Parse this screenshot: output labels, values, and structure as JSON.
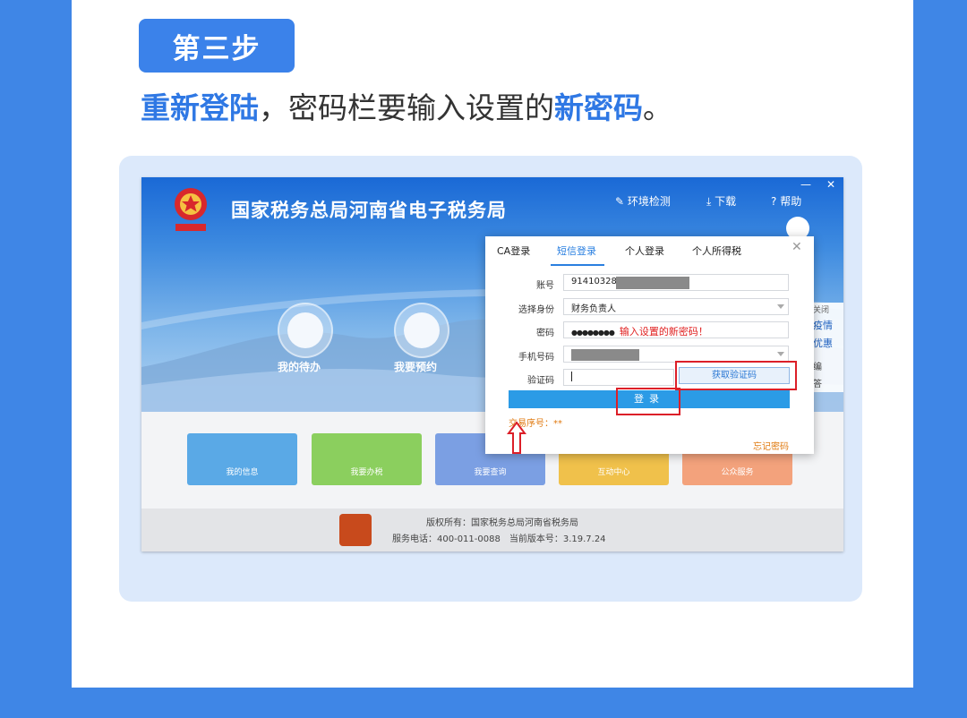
{
  "step": {
    "label": "第三步"
  },
  "headline": {
    "part1": "重新登陆",
    "part2": "，密码栏要输入设置的",
    "part3": "新密码",
    "part4": "。"
  },
  "site": {
    "title": "国家税务总局河南省电子税务局",
    "nav": [
      "环境检测",
      "下载",
      "帮助"
    ]
  },
  "quick_actions": [
    "我的待办",
    "我要预约"
  ],
  "tiles": [
    {
      "label": "我的信息",
      "color": "#5aa9e6"
    },
    {
      "label": "我要办税",
      "color": "#8bcf5e"
    },
    {
      "label": "我要查询",
      "color": "#7b9fe3"
    },
    {
      "label": "互动中心",
      "color": "#f0c14b"
    },
    {
      "label": "公众服务",
      "color": "#f3a27c"
    }
  ],
  "side_widget": [
    "关闭",
    "疫情",
    "优惠",
    "编",
    "答"
  ],
  "login_dialog": {
    "tabs": [
      "CA登录",
      "短信登录",
      "个人登录",
      "个人所得税"
    ],
    "active_tab": "短信登录",
    "fields": {
      "account": {
        "label": "账号",
        "value": "91410328"
      },
      "identity": {
        "label": "选择身份",
        "value": "财务负责人"
      },
      "password": {
        "label": "密码",
        "value": "●●●●●●●●",
        "hint": "输入设置的新密码！"
      },
      "phone": {
        "label": "手机号码"
      },
      "captcha": {
        "label": "验证码"
      }
    },
    "get_code_button": "获取验证码",
    "login_button": "登录",
    "serial": "交易序号：**",
    "forgot": "忘记密码"
  },
  "footer": {
    "copyright": "版权所有：国家税务总局河南省税务局",
    "info": "服务电话：400-011-0088　当前版本号：3.19.7.24"
  },
  "colors": {
    "background": "#3f86e6",
    "accent": "#3b82ea",
    "highlight": "#dc1f28",
    "button": "#2b9be6"
  }
}
